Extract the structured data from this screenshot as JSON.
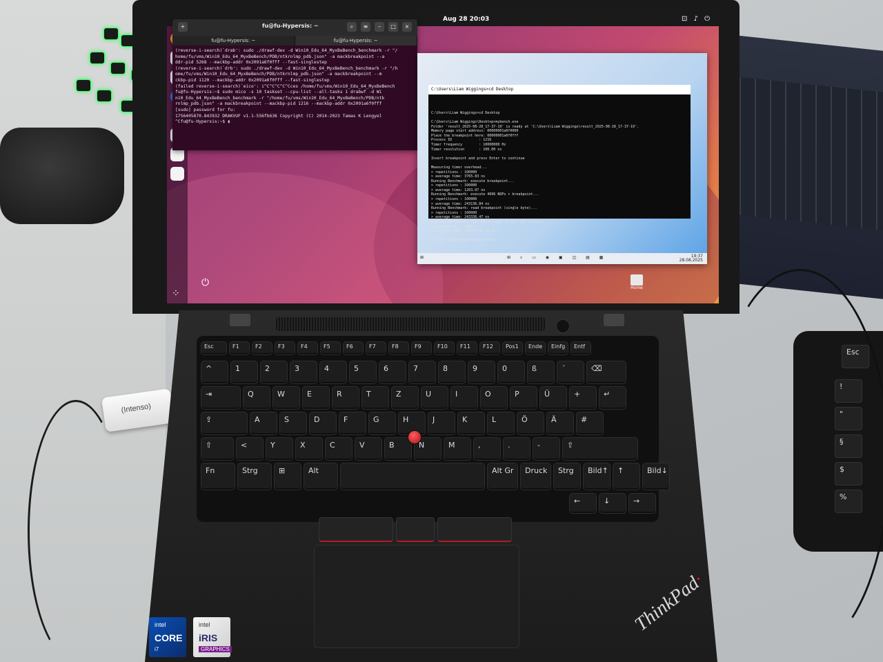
{
  "ubuntu": {
    "clock": "Aug 28 20:03",
    "system_tray": "⊡ ♪ ⏻",
    "terminal": {
      "title": "fu@fu-Hypersis: ~",
      "tabs": [
        "fu@fu-Hypersis: ~",
        "fu@fu-Hypersis: ~"
      ],
      "lines": [
        "(reverse-i-search)`drab': sudo ./drawf-dev -d Win10_Edu_64_MyxBeBench_benchmark -r \"/",
        "home/fu/vms/Win10_Edu_64_MyxBeBench/PDB/ntkrnlmp_pdb.json\" -a mackbreakpoint --a",
        "ddr-pid 5268 --mackbp-addr 0x2091a6f0fff --fast-singlestep",
        "(reverse-i-search)`drb': sudo ./drawf-dev -d Win10_Edu_64_MyxBeBench_benchmark -r \"/h",
        "ome/fu/vms/Win10_Edu_64_MyxBeBench/PDB/ntkrnlmp_pdb.json\" -a mackbreakpoint --m",
        "ckbp-pid 1120 --mackbp-addr 0x2091a6f0fff --fast-singlestep",
        "(failed reverse-i-search)`eico': i^C^C^C^C^Cces /home/fu/vms/Win10_Edu_64_MyxBeBench",
        "fu@fu-Hypersis:~$ sudo mico -s 10 taskset --cpu-list --all-tasks 1 drabwf -d Wi",
        "n10_Edu_64_MyxBeBench_benchmark -r \"/home/fu/vms/Win10_Edu_64_MyxBeBench/PDB/ntk",
        "rnlmp_pdb.json\" -a mackbreakpoint --mackbp-pid 1216 --mackbp-addr 0x2091a6f0fff",
        "[sudo] password for fu:",
        "1756405870.843932 DRAKVUF v1.1-556fb636 Copyright (C) 2014-2023 Tamas K Lengyel",
        "^Cfu@fu-Hypersis:~$ ▮"
      ]
    },
    "home_label": "Home"
  },
  "windows_vm": {
    "cmd_title": "C:\\Users\\Liam Wiggings>cd Desktop",
    "cmd_lines": [
      "C:\\Users\\Liam Wiggings>cd Desktop",
      "",
      "C:\\Users\\Liam Wiggings\\Desktop>mybench.exe",
      "Folder 'result_2025-08-28_17-37-19' is ready at 'C:\\Users\\Liam Wiggings\\result_2025-08-28_17-37-19'.",
      "Memory page start address: 00000001a6f0000",
      "Place the breakpoint here: 00000001a6f0fff",
      "Process ID             : 1216",
      "Timer frequency        : 10000000 Hz",
      "Timer resolution       : 100.00 ns",
      "",
      "Insert breakpoint and press Enter to continue",
      "",
      "Measuring timer overhead...",
      "> repetitions : 100000",
      "> average time: 3765.83 ns",
      "Running Benchmark: execute breakpoint...",
      "> repetitions : 100000",
      "> average time: 1203.07 ns",
      "Running Benchmark: execute 4096 NOPs + breakpoint...",
      "> repetitions : 100000",
      "> average time: 243136.84 ns",
      "Running Benchmark: read breakpoint (single byte)...",
      "> repetitions : 100000",
      "> average time: 243336.47 ns",
      "Running Benchmark: read whole page (4 byte per access)...",
      "> repetitions : 1000",
      "> average time: 188064190.18 ns",
      "",
      "C:\\Users\\Liam Wiggings\\Desktop>"
    ],
    "taskbar_icons": "⊞ ⌕ ▭ ◉ ▣ ◫ ▤ ▦",
    "time": "19:37",
    "date": "28.08.2025"
  },
  "laptop": {
    "brand": "ThinkPad",
    "stickers": {
      "core": {
        "brand": "intel",
        "name": "CORE",
        "sub": "i7"
      },
      "iris": {
        "brand": "intel",
        "name": "iRIS",
        "sub": "GRAPHICS"
      }
    },
    "keyboard_rows": [
      [
        "Esc",
        "F1",
        "F2",
        "F3",
        "F4",
        "F5",
        "F6",
        "F7",
        "F8",
        "F9",
        "F10",
        "F11",
        "F12",
        "Pos1",
        "Ende",
        "Einfg",
        "Entf"
      ],
      [
        "^",
        "1",
        "2",
        "3",
        "4",
        "5",
        "6",
        "7",
        "8",
        "9",
        "0",
        "ß",
        "´",
        "⌫"
      ],
      [
        "⇥",
        "Q",
        "W",
        "E",
        "R",
        "T",
        "Z",
        "U",
        "I",
        "O",
        "P",
        "Ü",
        "+",
        "↵"
      ],
      [
        "⇪",
        "A",
        "S",
        "D",
        "F",
        "G",
        "H",
        "J",
        "K",
        "L",
        "Ö",
        "Ä",
        "#"
      ],
      [
        "⇧",
        "<",
        "Y",
        "X",
        "C",
        "V",
        "B",
        "N",
        "M",
        ",",
        ".",
        "-",
        "⇧"
      ],
      [
        "Fn",
        "Strg",
        "⊞",
        "Alt",
        "",
        "Alt Gr",
        "Druck",
        "Strg",
        "Bild↑",
        "↑",
        "Bild↓"
      ],
      [
        "←",
        "↓",
        "→"
      ]
    ]
  },
  "peripherals": {
    "usb_label": "(Intenso)",
    "keyboard_keys": [
      "Esc",
      "!",
      "\"",
      "§",
      "$",
      "%"
    ]
  }
}
